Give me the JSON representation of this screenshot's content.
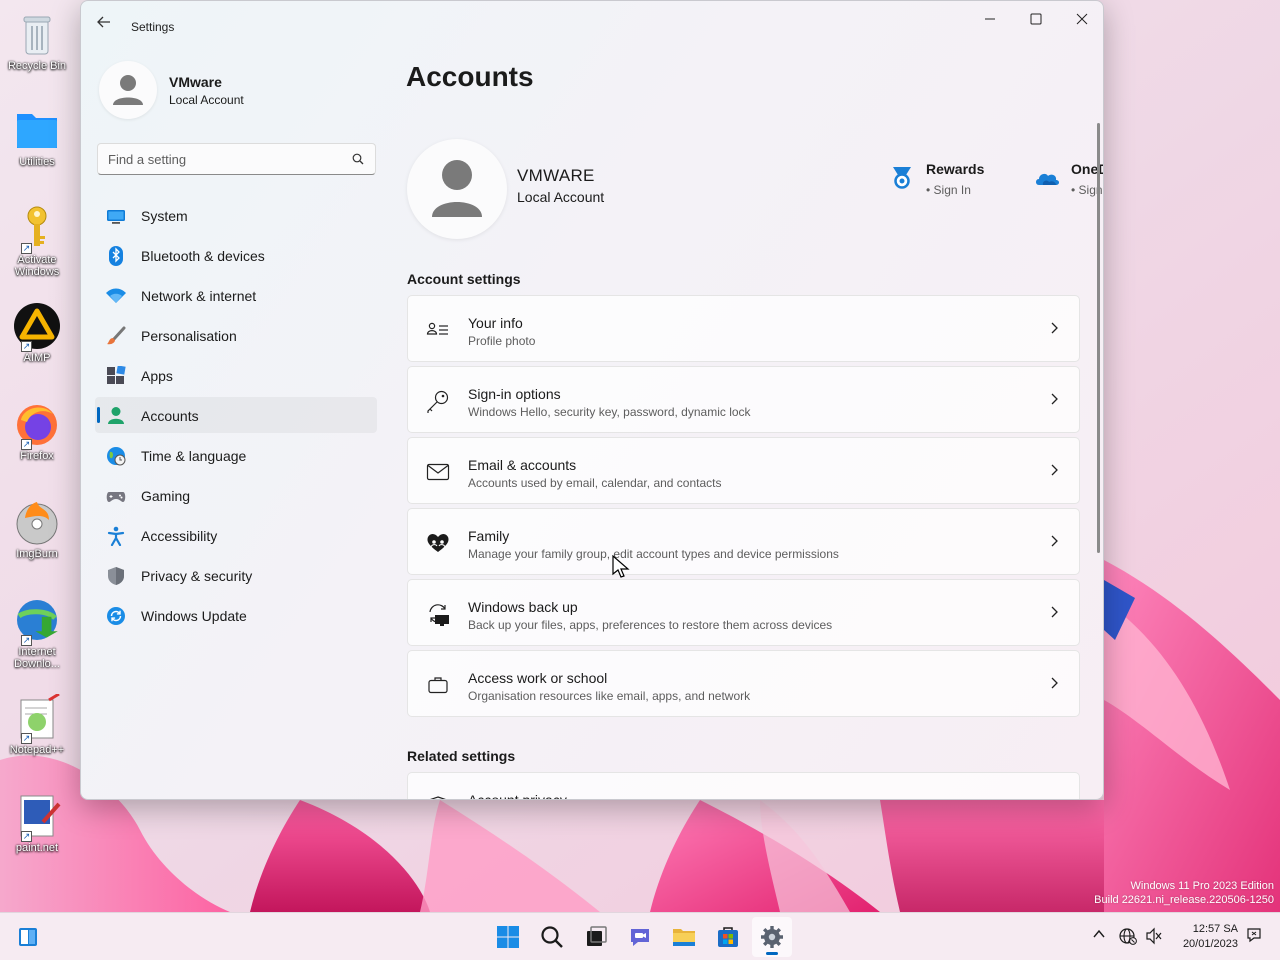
{
  "window": {
    "title": "Settings",
    "back_label": "Back",
    "minimize": "Minimize",
    "maximize": "Maximize",
    "close": "Close"
  },
  "sidebar": {
    "profile": {
      "name": "VMware",
      "type": "Local Account"
    },
    "search_placeholder": "Find a setting",
    "items": [
      {
        "label": "System",
        "icon": "monitor-icon"
      },
      {
        "label": "Bluetooth & devices",
        "icon": "bluetooth-icon"
      },
      {
        "label": "Network & internet",
        "icon": "wifi-icon"
      },
      {
        "label": "Personalisation",
        "icon": "brush-icon"
      },
      {
        "label": "Apps",
        "icon": "apps-icon"
      },
      {
        "label": "Accounts",
        "icon": "person-icon",
        "active": true
      },
      {
        "label": "Time & language",
        "icon": "globe-icon"
      },
      {
        "label": "Gaming",
        "icon": "gamepad-icon"
      },
      {
        "label": "Accessibility",
        "icon": "accessibility-icon"
      },
      {
        "label": "Privacy & security",
        "icon": "shield-icon"
      },
      {
        "label": "Windows Update",
        "icon": "update-icon"
      }
    ]
  },
  "main": {
    "page_title": "Accounts",
    "hero": {
      "name": "VMWARE",
      "type": "Local Account",
      "services": [
        {
          "title": "Rewards",
          "status": "Sign In",
          "icon": "rewards-medal-icon"
        },
        {
          "title": "OneDrive",
          "status": "Sign In",
          "icon": "onedrive-cloud-icon"
        }
      ]
    },
    "account_settings_heading": "Account settings",
    "cards": [
      {
        "title": "Your info",
        "subtitle": "Profile photo",
        "icon": "contact-card-icon"
      },
      {
        "title": "Sign-in options",
        "subtitle": "Windows Hello, security key, password, dynamic lock",
        "icon": "key-icon"
      },
      {
        "title": "Email & accounts",
        "subtitle": "Accounts used by email, calendar, and contacts",
        "icon": "mail-icon"
      },
      {
        "title": "Family",
        "subtitle": "Manage your family group, edit account types and device permissions",
        "icon": "family-heart-icon"
      },
      {
        "title": "Windows back up",
        "subtitle": "Back up your files, apps, preferences to restore them across devices",
        "icon": "backup-sync-icon"
      },
      {
        "title": "Access work or school",
        "subtitle": "Organisation resources like email, apps, and network",
        "icon": "briefcase-icon"
      }
    ],
    "related_settings_heading": "Related settings",
    "related_cards": [
      {
        "title": "Account privacy",
        "icon": "shield-icon"
      }
    ]
  },
  "desktop": {
    "icons": [
      {
        "label": "Recycle Bin",
        "icon": "recycle-bin-icon"
      },
      {
        "label": "Utilities",
        "icon": "folder-icon"
      },
      {
        "label": "Activate Windows",
        "icon": "key-icon"
      },
      {
        "label": "AIMP",
        "icon": "aimp-icon"
      },
      {
        "label": "Firefox",
        "icon": "firefox-icon"
      },
      {
        "label": "ImgBurn",
        "icon": "imgburn-icon"
      },
      {
        "label": "Internet Downlo...",
        "icon": "idm-icon"
      },
      {
        "label": "Notepad++",
        "icon": "notepadpp-icon"
      },
      {
        "label": "paint.net",
        "icon": "paintnet-icon"
      }
    ],
    "watermark_line1": "Windows 11 Pro 2023 Edition",
    "watermark_line2": "Build 22621.ni_release.220506-1250"
  },
  "taskbar": {
    "apps": [
      {
        "name": "start-button",
        "icon": "windows-logo-icon"
      },
      {
        "name": "search-button",
        "icon": "search-icon"
      },
      {
        "name": "task-view-button",
        "icon": "task-view-icon"
      },
      {
        "name": "chat-button",
        "icon": "chat-icon"
      },
      {
        "name": "file-explorer-button",
        "icon": "folder-icon"
      },
      {
        "name": "store-button",
        "icon": "store-icon"
      },
      {
        "name": "settings-button",
        "icon": "gear-icon",
        "active": true
      }
    ],
    "time": "12:57 SA",
    "date": "20/01/2023"
  },
  "colors": {
    "accent": "#0067c0",
    "window_bg": "#f3f3f3",
    "text_primary": "#1b1b1b",
    "text_secondary": "#5d5d5d"
  }
}
